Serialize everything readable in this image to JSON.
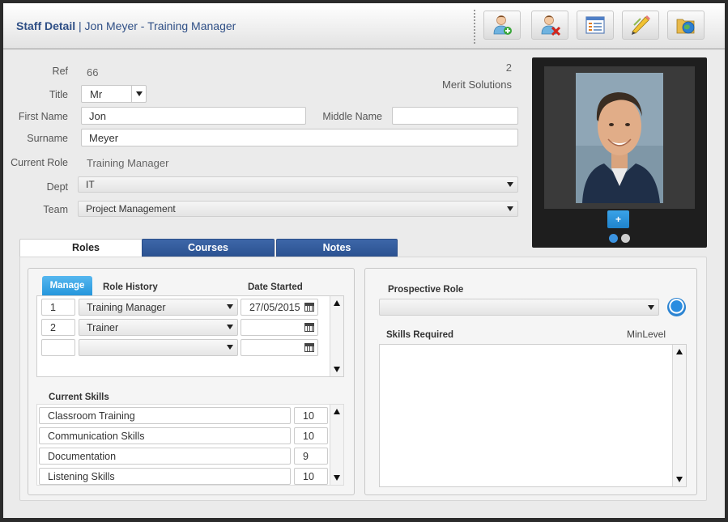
{
  "header": {
    "title_strong": "Staff Detail",
    "title_sep": " | ",
    "title_rest": "Jon Meyer - Training Manager",
    "toolbar": [
      {
        "name": "add-staff-icon"
      },
      {
        "name": "delete-staff-icon"
      },
      {
        "name": "list-view-icon"
      },
      {
        "name": "edit-pencil-icon"
      },
      {
        "name": "globe-folder-icon"
      }
    ]
  },
  "form": {
    "ref_label": "Ref",
    "ref_value": "66",
    "company_number": "2",
    "company_name": "Merit Solutions",
    "title_label": "Title",
    "title_value": "Mr",
    "first_name_label": "First Name",
    "first_name_value": "Jon",
    "middle_name_label": "Middle Name",
    "middle_name_value": "",
    "surname_label": "Surname",
    "surname_value": "Meyer",
    "current_role_label": "Current Role",
    "current_role_value": "Training Manager",
    "dept_label": "Dept",
    "dept_value": "IT",
    "team_label": "Team",
    "team_value": "Project Management"
  },
  "photo": {
    "add_label": "+"
  },
  "tabs": [
    {
      "label": "Roles",
      "active": true
    },
    {
      "label": "Courses",
      "active": false
    },
    {
      "label": "Notes",
      "active": false
    }
  ],
  "roles": {
    "manage_tab": "Manage",
    "history_header": "Role History",
    "date_header": "Date Started",
    "rows": [
      {
        "num": "1",
        "role": "Training Manager",
        "date": "27/05/2015"
      },
      {
        "num": "2",
        "role": "Trainer",
        "date": ""
      },
      {
        "num": "",
        "role": "",
        "date": ""
      }
    ],
    "skills_header": "Current Skills",
    "skills": [
      {
        "name": "Classroom Training",
        "level": "10"
      },
      {
        "name": "Communication Skills",
        "level": "10"
      },
      {
        "name": "Documentation",
        "level": "9"
      },
      {
        "name": "Listening Skills",
        "level": "10"
      }
    ]
  },
  "prospective": {
    "label": "Prospective Role",
    "value": "",
    "skills_label": "Skills Required",
    "min_level_label": "MinLevel"
  },
  "colors": {
    "accent_blue": "#2c5392",
    "manage_blue": "#2596dc"
  }
}
